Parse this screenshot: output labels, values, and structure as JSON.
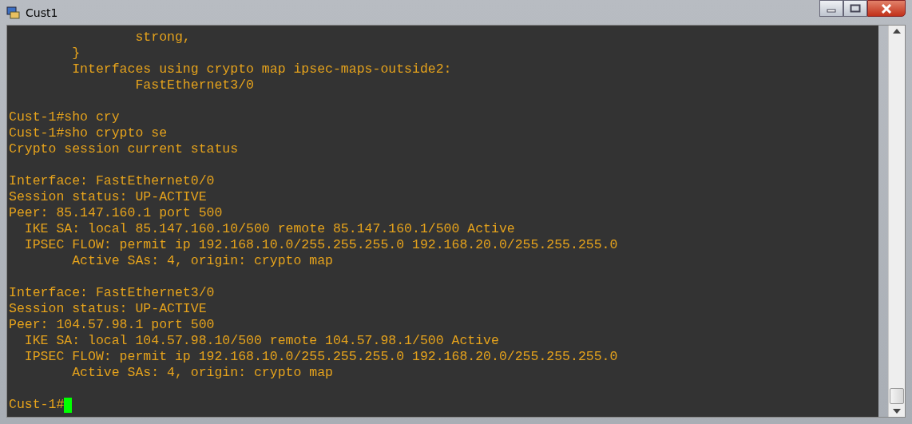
{
  "window": {
    "title": "Cust1"
  },
  "terminal": {
    "blocks": [
      [
        "                strong,",
        "        }",
        "        Interfaces using crypto map ipsec-maps-outside2:",
        "                FastEthernet3/0"
      ],
      [
        "Cust-1#sho cry",
        "Cust-1#sho crypto se",
        "Crypto session current status"
      ],
      [
        "Interface: FastEthernet0/0",
        "Session status: UP-ACTIVE",
        "Peer: 85.147.160.1 port 500",
        "  IKE SA: local 85.147.160.10/500 remote 85.147.160.1/500 Active",
        "  IPSEC FLOW: permit ip 192.168.10.0/255.255.255.0 192.168.20.0/255.255.255.0",
        "        Active SAs: 4, origin: crypto map"
      ],
      [
        "Interface: FastEthernet3/0",
        "Session status: UP-ACTIVE",
        "Peer: 104.57.98.1 port 500",
        "  IKE SA: local 104.57.98.10/500 remote 104.57.98.1/500 Active",
        "  IPSEC FLOW: permit ip 192.168.10.0/255.255.255.0 192.168.20.0/255.255.255.0",
        "        Active SAs: 4, origin: crypto map"
      ]
    ],
    "prompt": "Cust-1#"
  }
}
